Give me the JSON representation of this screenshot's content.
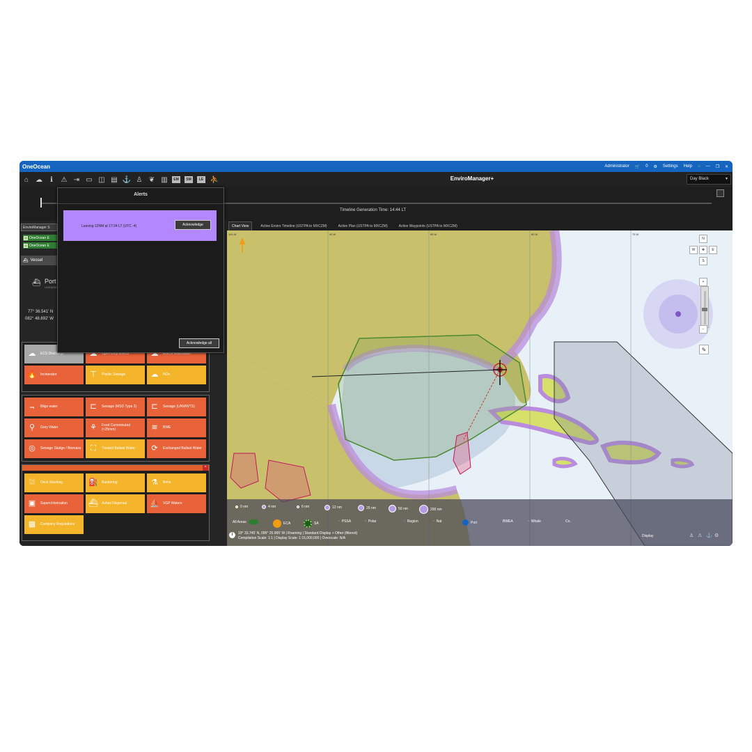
{
  "app": {
    "brand": "OneOcean",
    "title": "EnviroManager+"
  },
  "titlebar": {
    "user": "Administrator",
    "cart_count": "0",
    "settings": "Settings",
    "help": "Help"
  },
  "toolbar": {
    "box1": "EM",
    "box2": "SM",
    "box3": "LE"
  },
  "theme_select": {
    "value": "Day Black"
  },
  "timeline": {
    "caption": "Timeline Generation Time: 14:44 LT"
  },
  "left_panel": {
    "header": "EnviroManager S",
    "layers": [
      "OneOcean E",
      "OneOcean E"
    ],
    "vessel_tab": "Vessel",
    "vessel_name": "Port",
    "vessel_sub": "UNKNOWN",
    "lat": "77° 36.541' N",
    "lon": "082° 48.892' W",
    "group1": {
      "tiles": [
        {
          "label": "ECS Discharge",
          "icon": "cloud-icon",
          "color": "grey"
        },
        {
          "label": "Open-loop EGCS",
          "icon": "cloud-icon",
          "color": "orange"
        },
        {
          "label": "EGCS Washwater",
          "icon": "cloud-icon",
          "color": "orange"
        },
        {
          "label": "Incinerator",
          "icon": "flame-icon",
          "color": "orange"
        },
        {
          "label": "Plastic Sewage",
          "icon": "plunger-icon",
          "color": "yellow"
        },
        {
          "label": "NOx",
          "icon": "cloud-icon",
          "color": "yellow"
        }
      ]
    },
    "group2": {
      "tiles": [
        {
          "label": "Bilge water",
          "icon": "pipe-icon",
          "color": "orange"
        },
        {
          "label": "Sewage (MSD Type 2)",
          "icon": "toilet-icon",
          "color": "orange"
        },
        {
          "label": "Sewage (UNWWTS)",
          "icon": "toilet-icon",
          "color": "orange"
        },
        {
          "label": "Grey Water",
          "icon": "tap-icon",
          "color": "orange"
        },
        {
          "label": "Food Comminuted (<25mm)",
          "icon": "food-icon",
          "color": "orange"
        },
        {
          "label": "BWE",
          "icon": "waves-icon",
          "color": "orange"
        },
        {
          "label": "Sewage Sludge / Biomass",
          "icon": "sludge-icon",
          "color": "orange"
        },
        {
          "label": "Treated Ballast Water",
          "icon": "ballast-icon",
          "color": "yellow"
        },
        {
          "label": "Exchanged Ballast Water",
          "icon": "exchange-icon",
          "color": "orange"
        }
      ]
    },
    "group3": {
      "tiles": [
        {
          "label": "Deck Washing",
          "icon": "wash-icon",
          "color": "yellow"
        },
        {
          "label": "Bunkering",
          "icon": "bunker-icon",
          "color": "yellow"
        },
        {
          "label": "Brine",
          "icon": "brine-icon",
          "color": "yellow"
        },
        {
          "label": "Superchlorination",
          "icon": "tank-icon",
          "color": "orange"
        },
        {
          "label": "Ashes Dispersal",
          "icon": "ashes-icon",
          "color": "yellow"
        },
        {
          "label": "VGP Waters",
          "icon": "vgp-icon",
          "color": "orange"
        },
        {
          "label": "Company Regulations",
          "icon": "building-icon",
          "color": "yellow"
        }
      ]
    }
  },
  "alerts": {
    "title": "Alerts",
    "message": "Leaving 12NM at 17:24 LT (UTC -4)",
    "ack_label": "Acknowledge",
    "ack_all_label": "Acknowledge all",
    "color": "#b388ff"
  },
  "tabs": [
    "Chart View",
    "Active Enviro Timeline (USTPA to MXCZM)",
    "Active Plan (USTPA to MXCZM)",
    "Active Waypoints (USTPA to MXCZM)"
  ],
  "map": {
    "lon_labels": [
      "100 W",
      "90 W",
      "85 W",
      "80 W",
      "75 W",
      "70 W"
    ],
    "nav": {
      "n": "N",
      "w": "W",
      "e": "E",
      "s": "S"
    },
    "ranges": [
      "0 nm",
      "4 nm",
      "6 nm",
      "12 nm",
      "25 nm",
      "50 nm",
      "200 nm"
    ],
    "layers": [
      "All Areas",
      "ECA",
      "SA",
      "PSSA",
      "Polar",
      "Region",
      "Nat",
      "Port",
      "BWEA",
      "Whale",
      "Co."
    ],
    "status_line1": "19° 33.745' N, 099° 25.965' W | Roaming | Standard Display + Other (filtered)",
    "status_line2": "Compilation Scale: 1:1  | Display Scale: 1:15,000,000  | Overscale: N/A",
    "display_label": "Display"
  },
  "colors": {
    "titlebar": "#1565c0",
    "orange_tile": "#e8623a",
    "yellow_tile": "#f4b52a",
    "grey_tile": "#a8a8a8"
  }
}
